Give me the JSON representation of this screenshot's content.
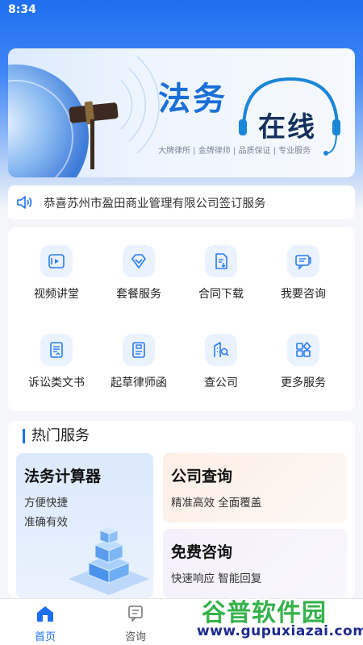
{
  "status_bar": {
    "time": "8:34"
  },
  "banner": {
    "title": "法务",
    "subtitle": "在线",
    "tagline": "大牌律所 | 金牌律师 | 品质保证 | 专业服务"
  },
  "notice": {
    "text": "恭喜苏州市盈田商业管理有限公司签订服务"
  },
  "grid": {
    "items": [
      {
        "label": "视频讲堂",
        "icon": "video-icon"
      },
      {
        "label": "套餐服务",
        "icon": "diamond-icon"
      },
      {
        "label": "合同下载",
        "icon": "contract-download-icon"
      },
      {
        "label": "我要咨询",
        "icon": "chat-icon"
      },
      {
        "label": "诉讼类文书",
        "icon": "document-icon"
      },
      {
        "label": "起草律师函",
        "icon": "letter-icon"
      },
      {
        "label": "查公司",
        "icon": "company-search-icon"
      },
      {
        "label": "更多服务",
        "icon": "more-services-icon"
      }
    ]
  },
  "hot": {
    "title": "热门服务",
    "services": [
      {
        "name": "法务计算器",
        "desc1": "方便快捷",
        "desc2": "准确有效"
      },
      {
        "name": "公司查询",
        "desc1": "精准高效 全面覆盖"
      },
      {
        "name": "免费咨询",
        "desc1": "快速响应 智能回复"
      }
    ]
  },
  "bottom_nav": {
    "items": [
      {
        "label": "首页",
        "active": true
      },
      {
        "label": "咨询",
        "active": false
      }
    ]
  },
  "watermark": {
    "title": "谷普软件园",
    "url": "www.gupuxiazai.com"
  },
  "colors": {
    "primary": "#1e6ff0",
    "accent_green": "#35b24a",
    "nav_active": "#1e6ff0",
    "nav_inactive": "#555555"
  }
}
